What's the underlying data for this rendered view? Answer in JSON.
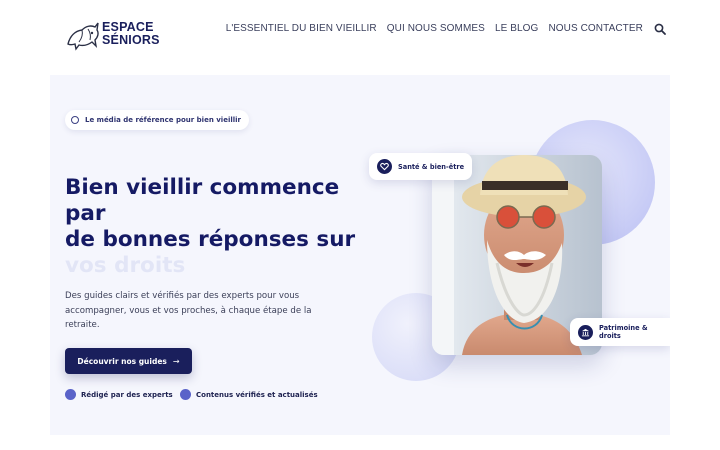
{
  "brand": {
    "line1": "ESPACE",
    "line2": "SÉNIORS"
  },
  "nav": {
    "items": [
      "L'ESSENTIEL DU BIEN VIEILLIR",
      "QUI NOUS SOMMES",
      "LE BLOG",
      "NOUS CONTACTER"
    ],
    "search_icon": "search-icon"
  },
  "hero": {
    "badge": "Le média de référence pour bien vieillir",
    "headline_line1": "Bien vieillir commence par",
    "headline_line2": "de bonnes réponses sur",
    "headline_ghost": "vos droits",
    "lead": "Des guides clairs et vérifiés par des experts pour vous accompagner, vous et vos proches, à chaque étape de la retraite.",
    "cta_label": "Découvrir nos guides",
    "cta_icon": "arrow-right-icon",
    "features": [
      "Rédigé par des experts",
      "Contenus vérifiés et actualisés"
    ],
    "tag_top": {
      "label": "Santé & bien-être",
      "icon": "heart-icon"
    },
    "tag_bottom": {
      "label": "Patrimoine & droits",
      "icon": "bank-icon"
    }
  },
  "colors": {
    "brand_navy": "#1a1f5c",
    "hero_bg": "#f5f6fd",
    "accent_circle": "#c9cdf6",
    "feature_dot": "#5a63c9"
  }
}
